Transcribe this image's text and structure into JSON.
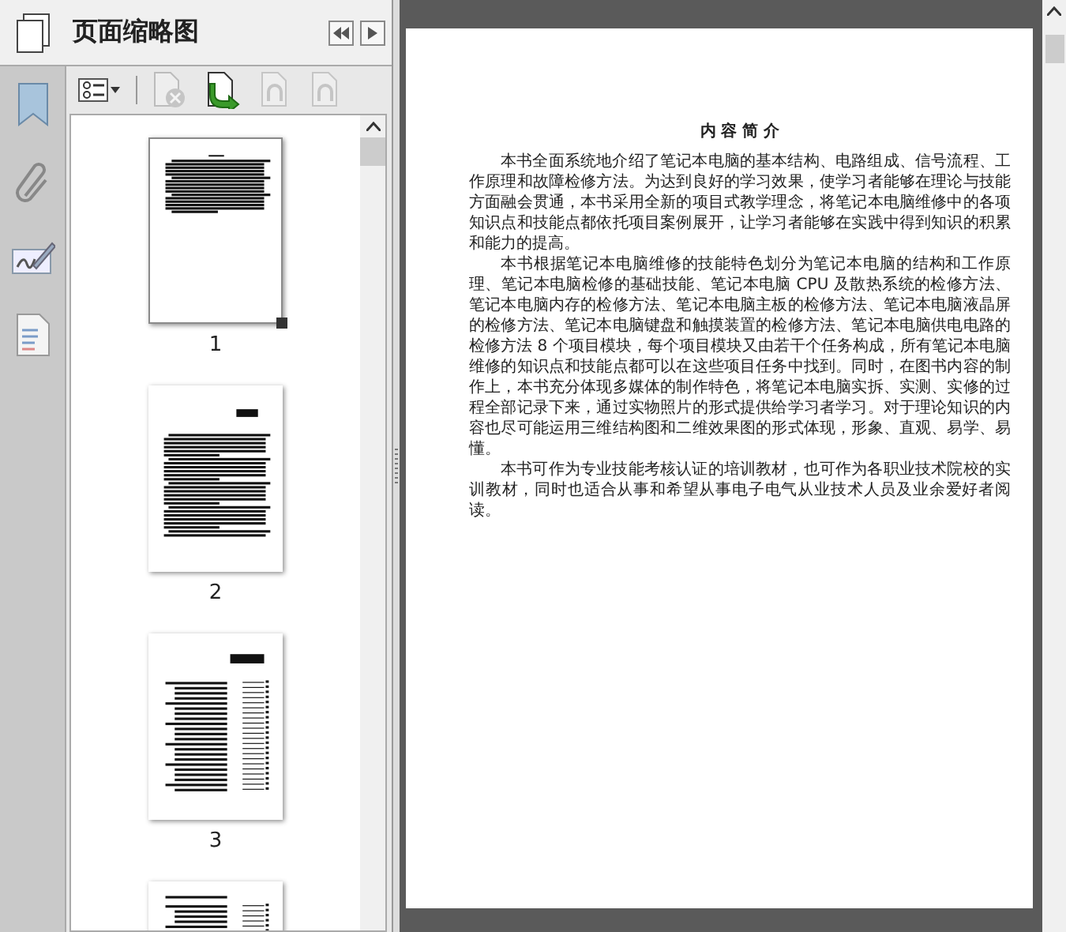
{
  "panel": {
    "title": "页面缩略图"
  },
  "toolbar": [
    {
      "kind": "options",
      "disabled": false
    },
    {
      "kind": "delete",
      "disabled": true
    },
    {
      "kind": "insert",
      "disabled": false
    },
    {
      "kind": "rotate-left",
      "disabled": true
    },
    {
      "kind": "rotate-right",
      "disabled": true
    }
  ],
  "rail": [
    {
      "kind": "bookmark"
    },
    {
      "kind": "attachment"
    },
    {
      "kind": "signature"
    },
    {
      "kind": "content"
    }
  ],
  "thumbnails": [
    {
      "label": "1",
      "kind": "text",
      "selected": true
    },
    {
      "label": "2",
      "kind": "preface",
      "selected": false
    },
    {
      "label": "3",
      "kind": "contents",
      "selected": false
    },
    {
      "kind": "contents-continued",
      "selected": false
    }
  ],
  "document": {
    "title": "内 容 简 介",
    "paragraphs": [
      "本书全面系统地介绍了笔记本电脑的基本结构、电路组成、信号流程、工作原理和故障检修方法。为达到良好的学习效果，使学习者能够在理论与技能方面融会贯通，本书采用全新的项目式教学理念，将笔记本电脑维修中的各项知识点和技能点都依托项目案例展开，让学习者能够在实践中得到知识的积累和能力的提高。",
      "本书根据笔记本电脑维修的技能特色划分为笔记本电脑的结构和工作原理、笔记本电脑检修的基础技能、笔记本电脑 CPU 及散热系统的检修方法、笔记本电脑内存的检修方法、笔记本电脑主板的检修方法、笔记本电脑液晶屏的检修方法、笔记本电脑键盘和触摸装置的检修方法、笔记本电脑供电电路的检修方法 8 个项目模块，每个项目模块又由若干个任务构成，所有笔记本电脑维修的知识点和技能点都可以在这些项目任务中找到。同时，在图书内容的制作上，本书充分体现多媒体的制作特色，将笔记本电脑实拆、实测、实修的过程全部记录下来，通过实物照片的形式提供给学习者学习。对于理论知识的内容也尽可能运用三维结构图和二维效果图的形式体现，形象、直观、易学、易懂。",
      "本书可作为专业技能考核认证的培训教材，也可作为各职业技术院校的实训教材，同时也适合从事和希望从事电子电气从业技术人员及业余爱好者阅读。"
    ]
  }
}
